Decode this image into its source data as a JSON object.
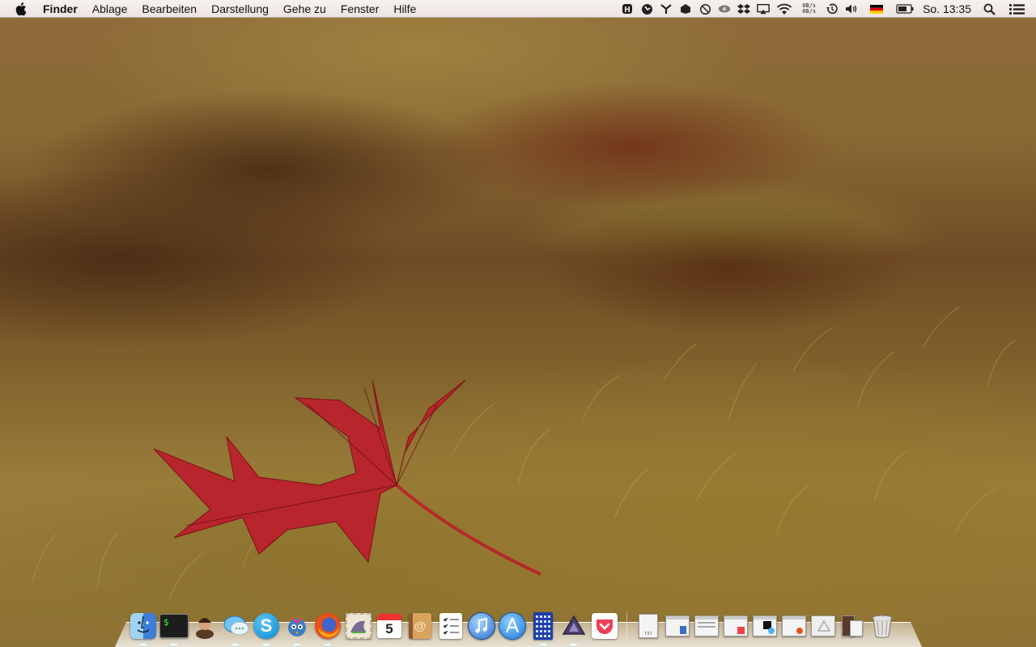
{
  "menubar": {
    "app_name": "Finder",
    "menus": [
      "Ablage",
      "Bearbeiten",
      "Darstellung",
      "Gehe zu",
      "Fenster",
      "Hilfe"
    ],
    "status_icons": [
      "hyperdock-icon",
      "skype-status-icon",
      "cloud-app-icon",
      "bartender-icon",
      "do-not-disturb-icon",
      "eye-icon",
      "dropbox-icon",
      "airplay-icon",
      "wifi-icon"
    ],
    "net_up": "0B/s",
    "net_down": "0B/s",
    "right_icons": [
      "time-machine-icon",
      "volume-icon",
      "german-flag-icon",
      "battery-icon"
    ],
    "clock": "So. 13:35",
    "tail_icons": [
      "spotlight-icon",
      "notification-center-icon"
    ]
  },
  "dock": {
    "apps": [
      {
        "name": "finder",
        "running": true
      },
      {
        "name": "terminal",
        "running": true,
        "text": "$"
      },
      {
        "name": "alfred",
        "running": false
      },
      {
        "name": "messages",
        "running": true
      },
      {
        "name": "skype",
        "running": true,
        "text": "S"
      },
      {
        "name": "tweetbot",
        "running": true
      },
      {
        "name": "firefox",
        "running": true
      },
      {
        "name": "mail-stamp",
        "running": false
      },
      {
        "name": "calendar",
        "running": false,
        "text": "5"
      },
      {
        "name": "contacts",
        "running": false,
        "text": "@"
      },
      {
        "name": "reminders",
        "running": false
      },
      {
        "name": "itunes",
        "running": false
      },
      {
        "name": "app-store",
        "running": false
      },
      {
        "name": "calculator",
        "running": true
      },
      {
        "name": "alfred-triangle",
        "running": true
      },
      {
        "name": "pocket",
        "running": false
      }
    ],
    "documents": [
      {
        "name": "text-document",
        "label": "TXT"
      },
      {
        "name": "window-thumbnail-1"
      },
      {
        "name": "window-thumbnail-2"
      },
      {
        "name": "window-thumbnail-3"
      },
      {
        "name": "window-thumbnail-4"
      },
      {
        "name": "window-thumbnail-5"
      },
      {
        "name": "window-thumbnail-6"
      },
      {
        "name": "downloads-stack"
      }
    ],
    "trash": "trash"
  }
}
